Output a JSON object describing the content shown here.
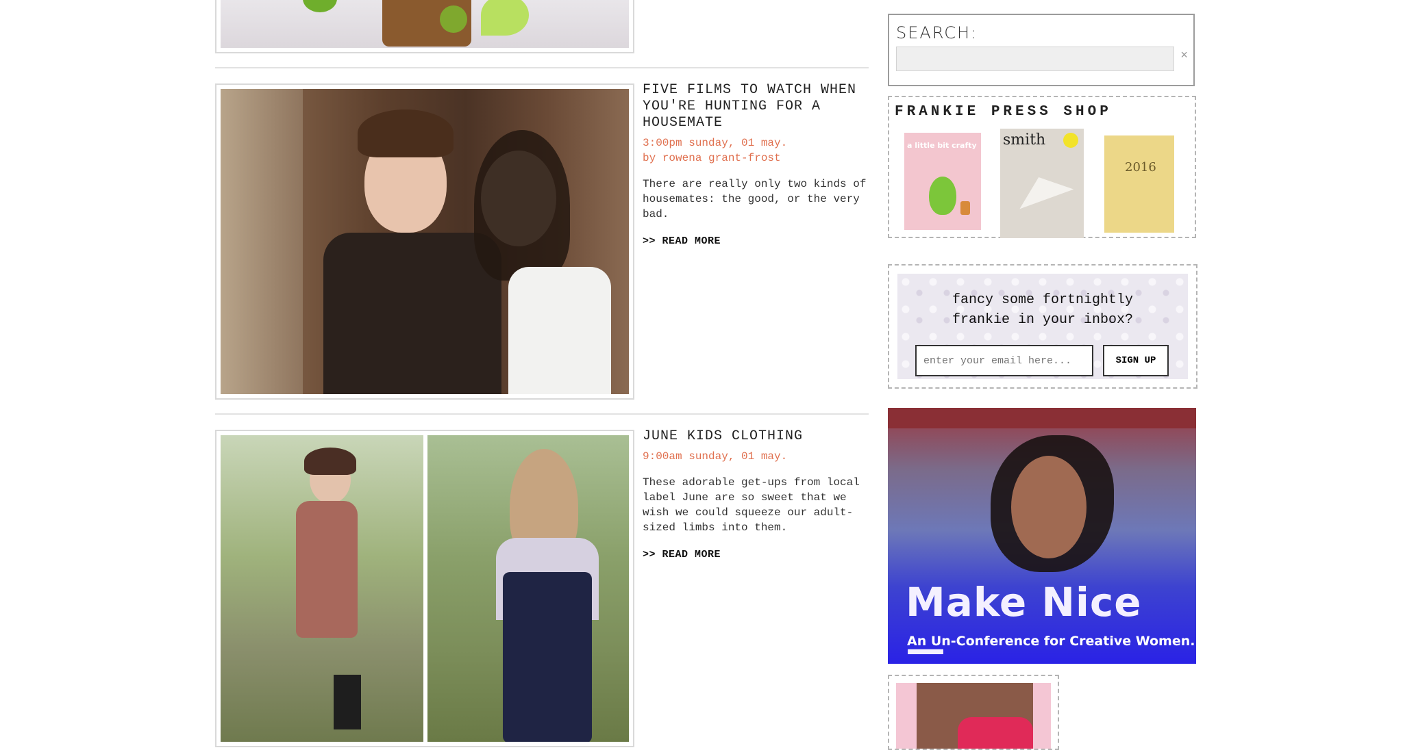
{
  "posts": [
    {
      "title": "FIVE FILMS TO WATCH WHEN YOU'RE HUNTING FOR A HOUSEMATE",
      "time": "3:00pm sunday, 01 may.",
      "author": "by rowena grant-frost",
      "excerpt": "There are really only two kinds of housemates: the good, or the very bad.",
      "read_more": ">> READ MORE"
    },
    {
      "title": "JUNE KIDS CLOTHING",
      "time": "9:00am sunday, 01 may.",
      "excerpt": "These adorable get-ups from local label June are so sweet that we wish we could squeeze our adult-sized limbs into them.",
      "read_more": ">> READ MORE"
    }
  ],
  "sidebar": {
    "search": {
      "label": "SEARCH:",
      "value": "",
      "clear_icon": "×"
    },
    "shop": {
      "title": "FRANKIE PRESS SHOP",
      "products": [
        {
          "label": "a little bit crafty"
        },
        {
          "label": "smith"
        },
        {
          "label": "2016"
        }
      ]
    },
    "newsletter": {
      "line1": "fancy some fortnightly",
      "line2": "frankie in your inbox?",
      "placeholder": "enter your email here...",
      "button": "SIGN UP"
    },
    "ad": {
      "headline": "Make Nice —",
      "subline": "An Un-Conference for Creative Women."
    }
  },
  "colors": {
    "meta": "#e0704f",
    "ad_blue": "#2a22e6"
  }
}
